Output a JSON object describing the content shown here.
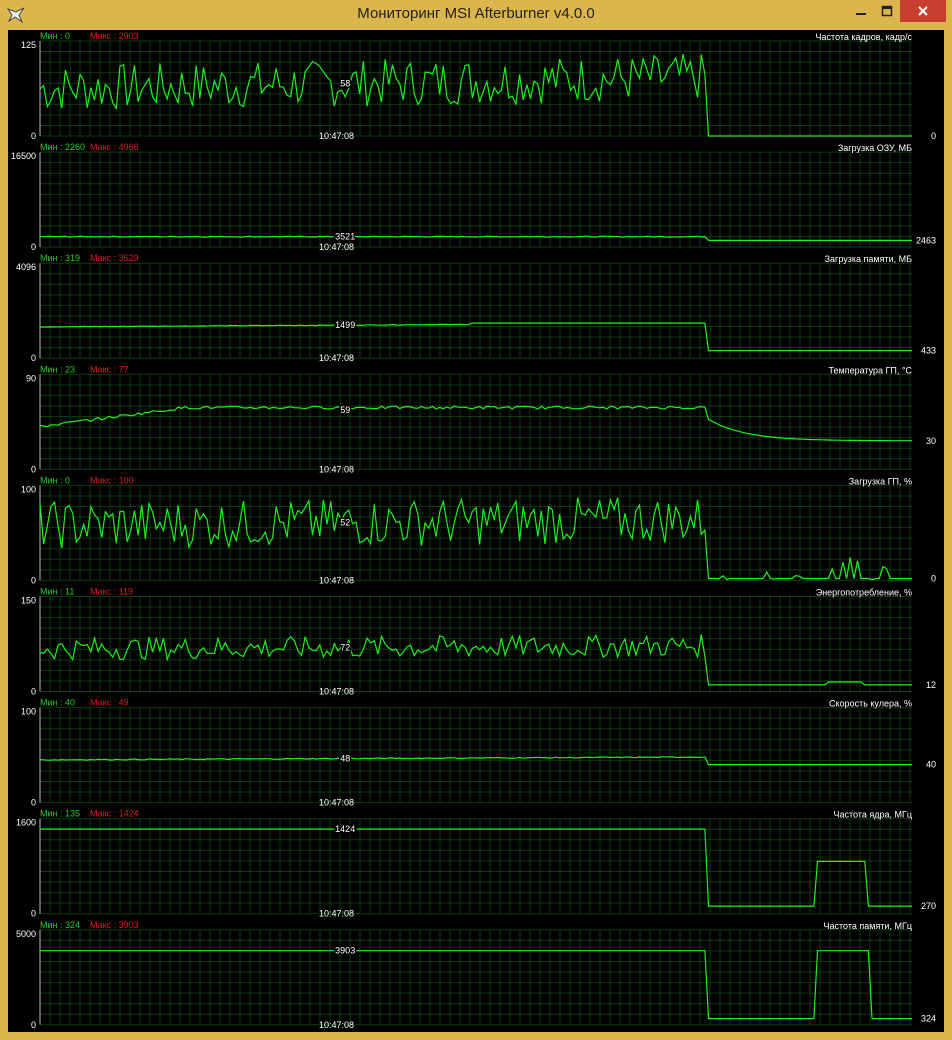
{
  "window": {
    "title": "Мониторинг MSI Afterburner v4.0.0",
    "icon": "afterburner-logo-icon",
    "buttons": [
      "minimize-icon",
      "maximize-icon",
      "close-icon"
    ]
  },
  "colors": {
    "frame": "#dcb64c",
    "background": "#000000",
    "grid": "#0d3a0d",
    "line": "#1ef01e",
    "min_label": "#1ecf1e",
    "max_label": "#d81e1e",
    "text": "#ffffff"
  },
  "timestamp": "10:47:08",
  "graphs": [
    {
      "title": "Частота кадров, кадр/с",
      "min_label": "Мин : 0",
      "max_label": "Макс : 2903",
      "y_top": "125",
      "y_bottom": "0",
      "ymax": 125,
      "cursor_value": "58",
      "current_value": "0"
    },
    {
      "title": "Загрузка ОЗУ, МБ",
      "min_label": "Мин : 2260",
      "max_label": "Макс : 4966",
      "y_top": "16500",
      "y_bottom": "0",
      "ymax": 16500,
      "cursor_value": "3521",
      "current_value": "2463"
    },
    {
      "title": "Загрузка памяти, МБ",
      "min_label": "Мин : 319",
      "max_label": "Макс : 3529",
      "y_top": "4096",
      "y_bottom": "0",
      "ymax": 4096,
      "cursor_value": "1499",
      "current_value": "433"
    },
    {
      "title": "Температура ГП, °С",
      "min_label": "Мин : 23",
      "max_label": "Макс : 77",
      "y_top": "90",
      "y_bottom": "0",
      "ymax": 90,
      "cursor_value": "59",
      "current_value": "30"
    },
    {
      "title": "Загрузка ГП, %",
      "min_label": "Мин : 0",
      "max_label": "Макс : 100",
      "y_top": "100",
      "y_bottom": "0",
      "ymax": 100,
      "cursor_value": "52",
      "current_value": "0"
    },
    {
      "title": "Энергопотребление, %",
      "min_label": "Мин : 11",
      "max_label": "Макс : 119",
      "y_top": "150",
      "y_bottom": "0",
      "ymax": 150,
      "cursor_value": "72",
      "current_value": "12"
    },
    {
      "title": "Скорость кулера, %",
      "min_label": "Мин : 40",
      "max_label": "Макс : 49",
      "y_top": "100",
      "y_bottom": "0",
      "ymax": 100,
      "cursor_value": "48",
      "current_value": "40"
    },
    {
      "title": "Частота ядра, МГц",
      "min_label": "Мин : 135",
      "max_label": "Макс : 1424",
      "y_top": "1600",
      "y_bottom": "0",
      "ymax": 1600,
      "cursor_value": "1424",
      "current_value": "270"
    },
    {
      "title": "Частота памяти, МГц",
      "min_label": "Мин : 324",
      "max_label": "Макс : 3903",
      "y_top": "5000",
      "y_bottom": "0",
      "ymax": 5000,
      "cursor_value": "3903",
      "current_value": "324"
    }
  ]
}
